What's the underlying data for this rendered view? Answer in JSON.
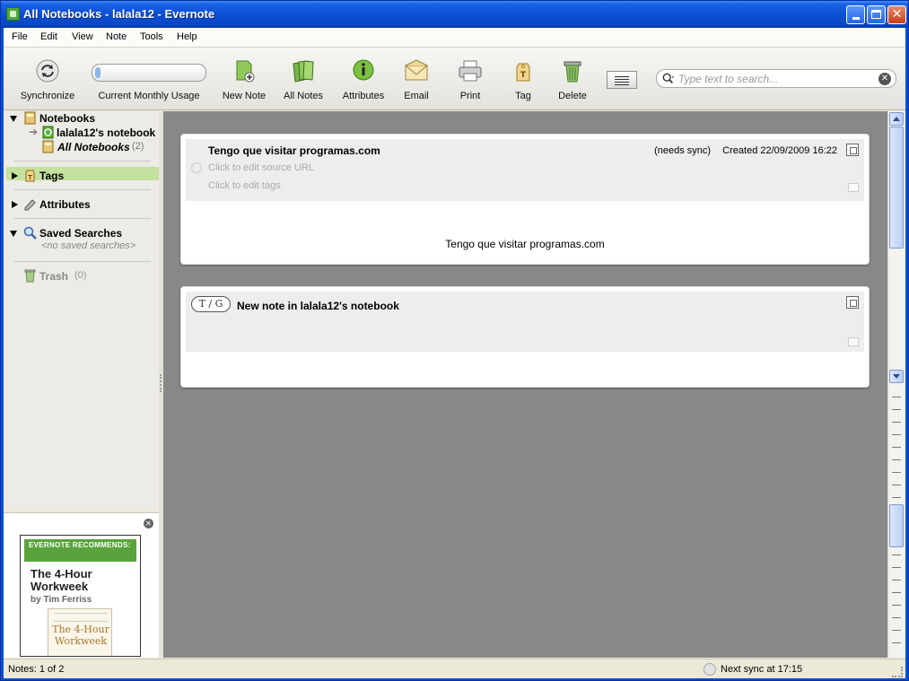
{
  "window": {
    "title": "All Notebooks - lalala12 - Evernote",
    "controls": {
      "minimize": "minimize",
      "maximize": "maximize",
      "close": "close"
    }
  },
  "menubar": {
    "items": [
      "File",
      "Edit",
      "View",
      "Note",
      "Tools",
      "Help"
    ]
  },
  "toolbar": {
    "synchronize": "Synchronize",
    "usage_label": "Current Monthly Usage",
    "usage_fraction": 0.03,
    "new_note": "New Note",
    "all_notes": "All Notes",
    "attributes": "Attributes",
    "email": "Email",
    "print": "Print",
    "tag": "Tag",
    "delete": "Delete",
    "search_placeholder": "Type text to search..."
  },
  "sidebar": {
    "notebooks": {
      "label": "Notebooks",
      "items": [
        {
          "label": "lalala12's notebook"
        },
        {
          "label": "All Notebooks",
          "count": "(2)",
          "selected": true
        }
      ]
    },
    "tags": {
      "label": "Tags"
    },
    "attributes": {
      "label": "Attributes"
    },
    "saved_searches": {
      "label": "Saved Searches",
      "empty": "<no saved searches>"
    },
    "trash": {
      "label": "Trash",
      "count": "(0)"
    }
  },
  "ad": {
    "header": "EVERNOTE RECOMMENDS:",
    "title": "The 4-Hour Workweek",
    "author": "by Tim Ferriss",
    "book_cover_title": "The 4-Hour Workweek"
  },
  "notes": [
    {
      "title": "Tengo que visitar programas.com",
      "status": "(needs sync)",
      "created": "Created 22/09/2009 16:22",
      "source_url_hint": "Click to edit source URL",
      "tags_hint": "Click to edit tags",
      "body": "Tengo que visitar programas.com"
    },
    {
      "title": "New note in lalala12's notebook",
      "tg_label": "T / G",
      "body": ""
    }
  ],
  "statusbar": {
    "notes_count": "Notes: 1 of 2",
    "next_sync": "Next sync at 17:15"
  },
  "colors": {
    "titlebar": "#0a4fd3",
    "selected": "#c4e19d",
    "notes_bg": "#888888",
    "ad_green": "#5aa33c"
  }
}
